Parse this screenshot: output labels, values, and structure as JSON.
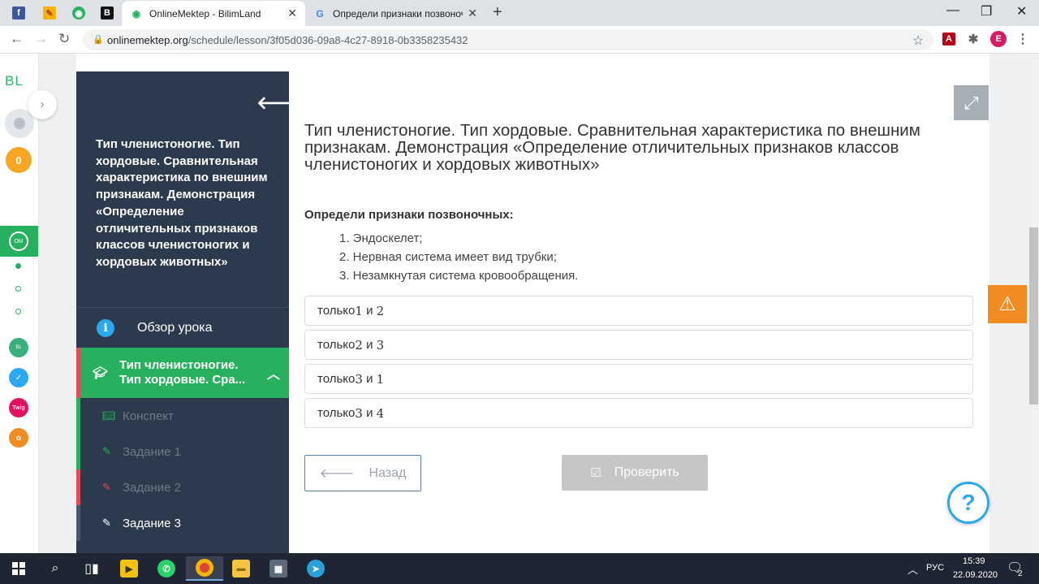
{
  "browser": {
    "pinned_tabs": [
      {
        "icon": "facebook-icon",
        "glyph": "f",
        "color": "#3b5998"
      },
      {
        "icon": "sticky-icon",
        "glyph": "✎",
        "color": "#f4b400"
      },
      {
        "icon": "onlinemektep-icon",
        "glyph": "◉",
        "color": "#27b15e"
      },
      {
        "icon": "bilim-icon",
        "glyph": "B",
        "color": "#111111"
      }
    ],
    "tabs": [
      {
        "title": "OnlineMektep - BilimLand",
        "close": "✕",
        "active": true
      },
      {
        "title": "Определи признаки позвоночн",
        "close": "✕",
        "active": false
      }
    ],
    "new_tab": "+",
    "window": {
      "minimize": "—",
      "restore": "❐",
      "close": "✕"
    },
    "url_host": "onlinemektep.org",
    "url_path": "/schedule/lesson/3f05d036-09a8-4c27-8918-0b3358235432",
    "profile_initial": "E"
  },
  "left_rail": {
    "logo": "BL",
    "points": "0"
  },
  "sidebar": {
    "title": "Тип членистоногие. Тип хордовые. Сравнительная характеристика по внешним признакам. Демонстрация «Определение отличительных признаков классов членистоногих и хордовых животных»",
    "overview_label": "Обзор урока",
    "current_label": "Тип членистоногие. Тип хордовые. Сра...",
    "subitems": [
      {
        "label": "Конспект",
        "icon": "book-icon",
        "color": "#27b15e",
        "text_color": "#6f7a86"
      },
      {
        "label": "Задание 1",
        "icon": "edit-icon",
        "color": "#27b15e",
        "text_color": "#6f7a86"
      },
      {
        "label": "Задание 2",
        "icon": "edit-icon",
        "color": "#e04d5a",
        "text_color": "#6f7a86"
      },
      {
        "label": "Задание 3",
        "icon": "edit-icon",
        "color": "#4a5a6c",
        "text_color": "#ffffff"
      }
    ]
  },
  "main": {
    "heading": "Тип членистоногие. Тип хордовые. Сравнительная характеристика по внешним признакам. Демонстрация «Определение отличительных признаков классов членистоногих и хордовых животных»",
    "question": "Определи признаки позвоночных:",
    "list": [
      "1. Эндоскелет;",
      "2. Нервная система имеет вид трубки;",
      "3. Незамкнутая система кровообращения."
    ],
    "options": [
      {
        "pre": "только ",
        "a": "1",
        "mid": " и ",
        "b": "2"
      },
      {
        "pre": "только ",
        "a": "2",
        "mid": " и ",
        "b": "3"
      },
      {
        "pre": "только ",
        "a": "3",
        "mid": " и ",
        "b": "1"
      },
      {
        "pre": "только ",
        "a": "3",
        "mid": " и ",
        "b": "4"
      }
    ],
    "back_label": "Назад",
    "check_label": "Проверить",
    "help_glyph": "?"
  },
  "taskbar": {
    "lang": "РУС",
    "time": "15:39",
    "date": "22.09.2020",
    "notifications": "2"
  },
  "colors": {
    "sidebar_bg": "#2b3a4c",
    "accent_green": "#27b15e",
    "accent_red": "#e04d5a",
    "warning_orange": "#f08c22",
    "help_blue": "#2aa9f0"
  }
}
